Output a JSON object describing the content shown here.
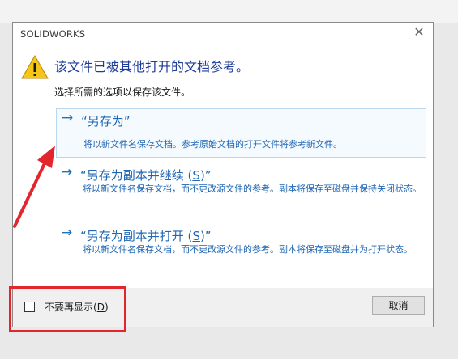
{
  "dialog": {
    "title": "SOLIDWORKS",
    "close_icon": "close-icon",
    "warning_icon": "warning-icon",
    "heading": "该文件已被其他打开的文档参考。",
    "instruction": "选择所需的选项以保存该文件。"
  },
  "options": [
    {
      "title_prefix": "“另存为”",
      "title_ul": "",
      "title_suffix": "",
      "desc": "将以新文件名保存文档。参考原始文档的打开文件将参考新文件。",
      "icon": "arrow-right-icon"
    },
    {
      "title_prefix": "“另存为副本并继续 (",
      "title_ul": "S",
      "title_suffix": ")”",
      "desc": "将以新文件名保存文档，而不更改源文件的参考。副本将保存至磁盘并保持关闭状态。",
      "icon": "arrow-right-icon"
    },
    {
      "title_prefix": "“另存为副本并打开 (",
      "title_ul": "S",
      "title_suffix": ")”",
      "desc": "将以新文件名保存文档，而不更改源文件的参考。副本将保存至磁盘并为打开状态。",
      "icon": "arrow-right-icon"
    }
  ],
  "footer": {
    "checkbox_prefix": "不要再显示(",
    "checkbox_ul": "D",
    "checkbox_suffix": ")",
    "cancel_label": "取消"
  },
  "colors": {
    "accent": "#1f66b3",
    "heading": "#1d3b9a",
    "annotation_red": "#e3262e",
    "warning_yellow": "#f5c518"
  }
}
